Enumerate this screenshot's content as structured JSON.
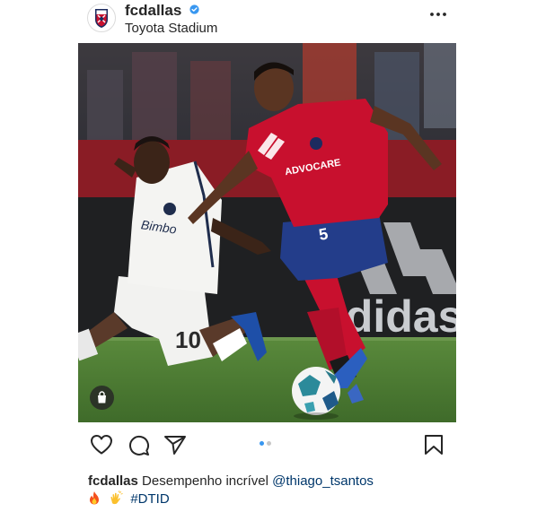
{
  "post": {
    "username": "fcdallas",
    "location": "Toyota Stadium",
    "photo_alt": "Soccer match: FC Dallas player in red kit number 5 dribbling past a Philadelphia Union player in white kit number 10",
    "shirt_home_number": "5",
    "shirt_away_number": "10",
    "ad_text": "adidas",
    "sponsor_text": "ADVOCARE",
    "away_sponsor_text": "Bimbo"
  },
  "caption": {
    "username": "fcdallas",
    "text": "Desempenho incrível",
    "mention": "@thiago_tsantos",
    "hashtag": "#DTID"
  },
  "carousel": {
    "total": 2,
    "active": 1
  },
  "colors": {
    "accent_blue": "#3897f0",
    "link": "#00376b",
    "text": "#262626",
    "dot_inactive": "#c7c7c7"
  },
  "icons": {
    "verified": "verified-badge-icon",
    "more": "more-options-icon",
    "like": "heart-icon",
    "comment": "comment-icon",
    "share": "send-icon",
    "save": "bookmark-icon",
    "shop": "shopping-bag-icon"
  }
}
